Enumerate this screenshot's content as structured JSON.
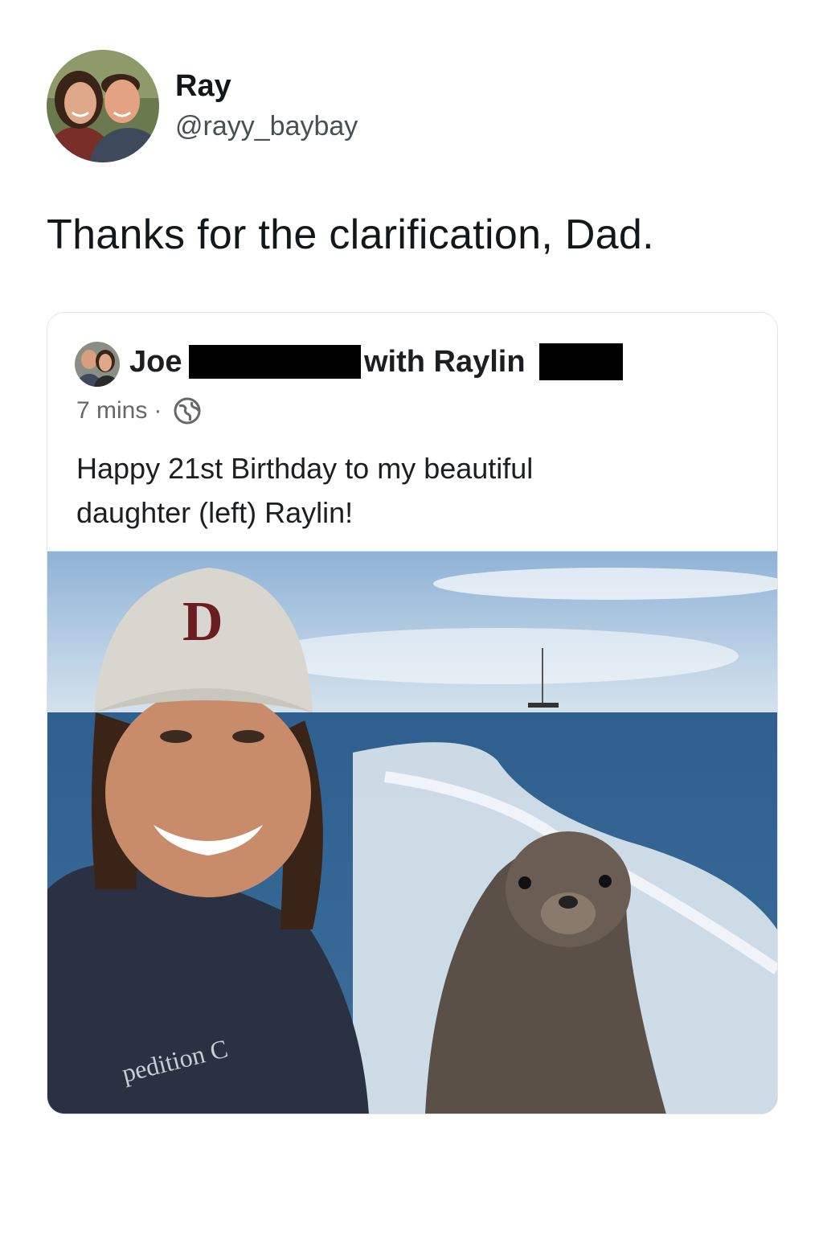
{
  "tweet": {
    "display_name": "Ray",
    "handle": "@rayy_baybay",
    "text": "Thanks for the clarification, Dad."
  },
  "embedded_post": {
    "author_first": "Joe",
    "with_text": "with Raylin",
    "time": "7 mins",
    "separator": "·",
    "privacy_icon": "globe-icon",
    "text_line1": "Happy 21st Birthday to my beautiful",
    "text_line2": "daughter (left) Raylin!",
    "photo": {
      "cap_logo": "D",
      "shirt_text": "pedition C"
    }
  }
}
